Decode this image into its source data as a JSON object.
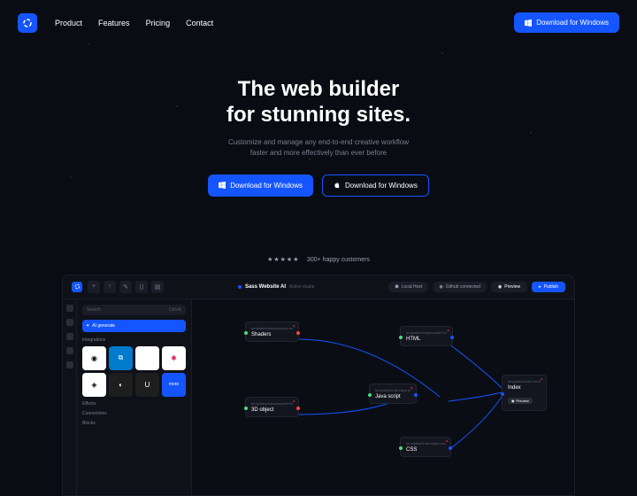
{
  "nav": {
    "items": [
      "Product",
      "Features",
      "Pricing",
      "Contact"
    ]
  },
  "header": {
    "cta": "Download for Windows"
  },
  "hero": {
    "title_l1": "The web builder",
    "title_l2": "for stunning sites.",
    "sub_l1": "Customize and manage any end-to-end creative workflow",
    "sub_l2": "faster and more effectively than ever before",
    "btn1": "Download for Windows",
    "btn2": "Download for Windows"
  },
  "social": {
    "text": "300+ happy customers"
  },
  "editor": {
    "title": "Sass Website AI",
    "subtitle": "Active studio",
    "status1": "Local Host",
    "status2": "Github connected",
    "preview": "Preview",
    "publish": "Publish",
    "search": "Search",
    "search_kbd": "Ctrl+K",
    "genai": "AI generate",
    "sections": [
      "Integrations",
      "Effects",
      "Connections",
      "Blocks"
    ],
    "nodes": {
      "shaders": {
        "header": "templates/subcomponents",
        "title": "Shaders"
      },
      "obj3d": {
        "header": "templates/subcomponents",
        "title": "3D object"
      },
      "html": {
        "header": "templates/body/header/v1",
        "title": "HTML"
      },
      "js": {
        "header": "templates/index/app.js",
        "title": "Java script"
      },
      "css": {
        "header": "templates/index/style.css",
        "title": "CSS"
      },
      "index": {
        "header": "templates/index.html",
        "title": "Index",
        "preview": "Preview"
      }
    }
  }
}
